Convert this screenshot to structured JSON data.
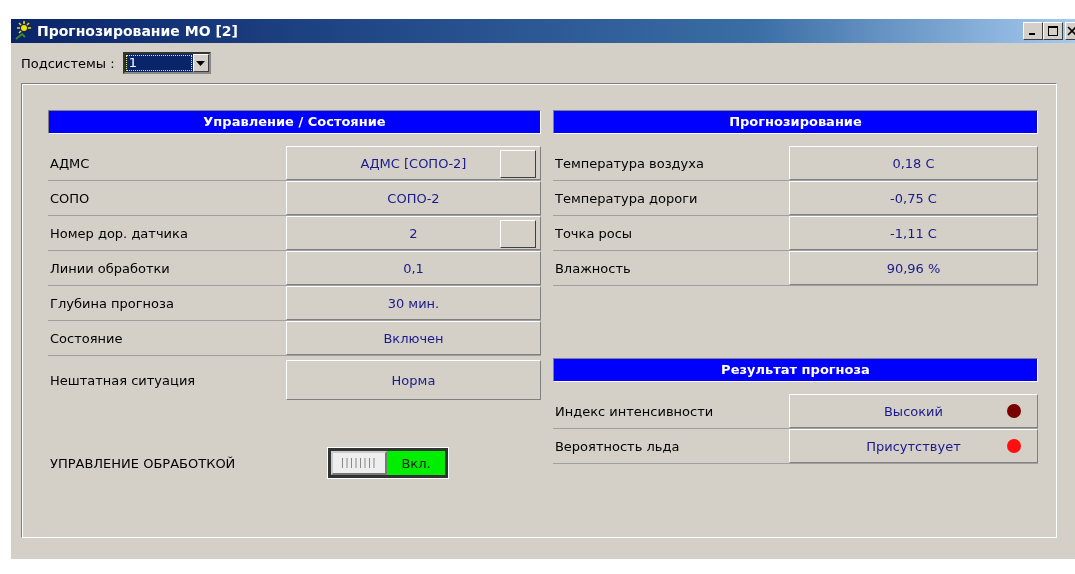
{
  "window": {
    "title": "Прогнозирование МО [2]"
  },
  "subsystem": {
    "label": "Подсистемы :",
    "value": "1"
  },
  "control_panel": {
    "title": "Управление / Состояние",
    "rows": [
      {
        "label": "АДМС",
        "value": "АДМС [СОПО-2]",
        "has_button": true
      },
      {
        "label": "СОПО",
        "value": "СОПО-2",
        "has_button": false
      },
      {
        "label": "Номер дор. датчика",
        "value": "2",
        "has_button": true
      },
      {
        "label": "Линии обработки",
        "value": "0,1",
        "has_button": false
      },
      {
        "label": "Глубина прогноза",
        "value": "30 мин.",
        "has_button": false
      },
      {
        "label": "Состояние",
        "value": "Включен",
        "has_button": false
      },
      {
        "label": "Нештатная ситуация",
        "value": "Норма",
        "has_button": false
      }
    ],
    "processing_toggle": {
      "label": "УПРАВЛЕНИЕ ОБРАБОТКОЙ",
      "on": true,
      "state_text": "Вкл."
    }
  },
  "forecast_panel": {
    "title": "Прогнозирование",
    "rows": [
      {
        "label": "Температура воздуха",
        "value": "0,18 С"
      },
      {
        "label": "Температура дороги",
        "value": "-0,75 С"
      },
      {
        "label": "Точка росы",
        "value": "-1,11 С"
      },
      {
        "label": "Влажность",
        "value": "90,96 %"
      }
    ]
  },
  "result_panel": {
    "title": "Результат прогноза",
    "rows": [
      {
        "label": "Индекс интенсивности",
        "value": "Высокий",
        "color": "#7a0000"
      },
      {
        "label": "Вероятность льда",
        "value": "Присутствует",
        "color": "#ff1010"
      }
    ]
  }
}
